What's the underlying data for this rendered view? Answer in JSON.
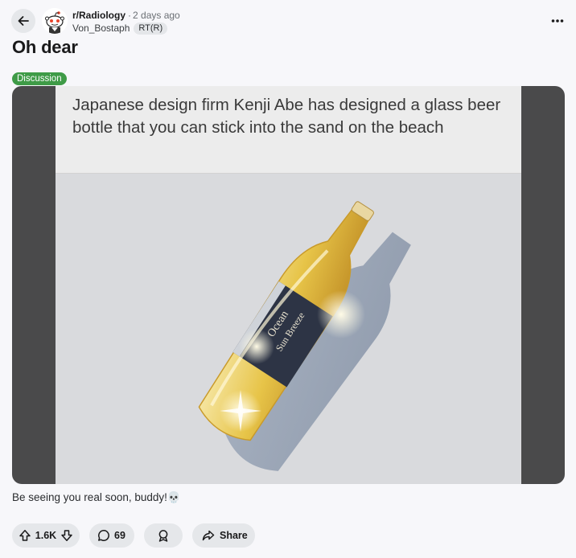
{
  "post": {
    "subreddit": "r/Radiology",
    "separator": "·",
    "time_ago": "2 days ago",
    "author": "Von_Bostaph",
    "author_flair": "RT(R)",
    "title": "Oh dear",
    "tag": "Discussion",
    "tag_color": "#3f9b47",
    "body": "Be seeing you real soon, buddy!💀"
  },
  "media": {
    "caption": "Japanese design firm Kenji Abe has designed a glass beer bottle that you can stick into the sand on the beach",
    "label_text_1": "Ocean",
    "label_text_2": "Sun Breeze"
  },
  "actions": {
    "votes": "1.6K",
    "comments": "69",
    "share_label": "Share"
  },
  "icons": [
    "back-arrow-icon",
    "snoo-avatar-icon",
    "more-options-icon",
    "upvote-icon",
    "downvote-icon",
    "comment-icon",
    "award-icon",
    "share-icon"
  ]
}
